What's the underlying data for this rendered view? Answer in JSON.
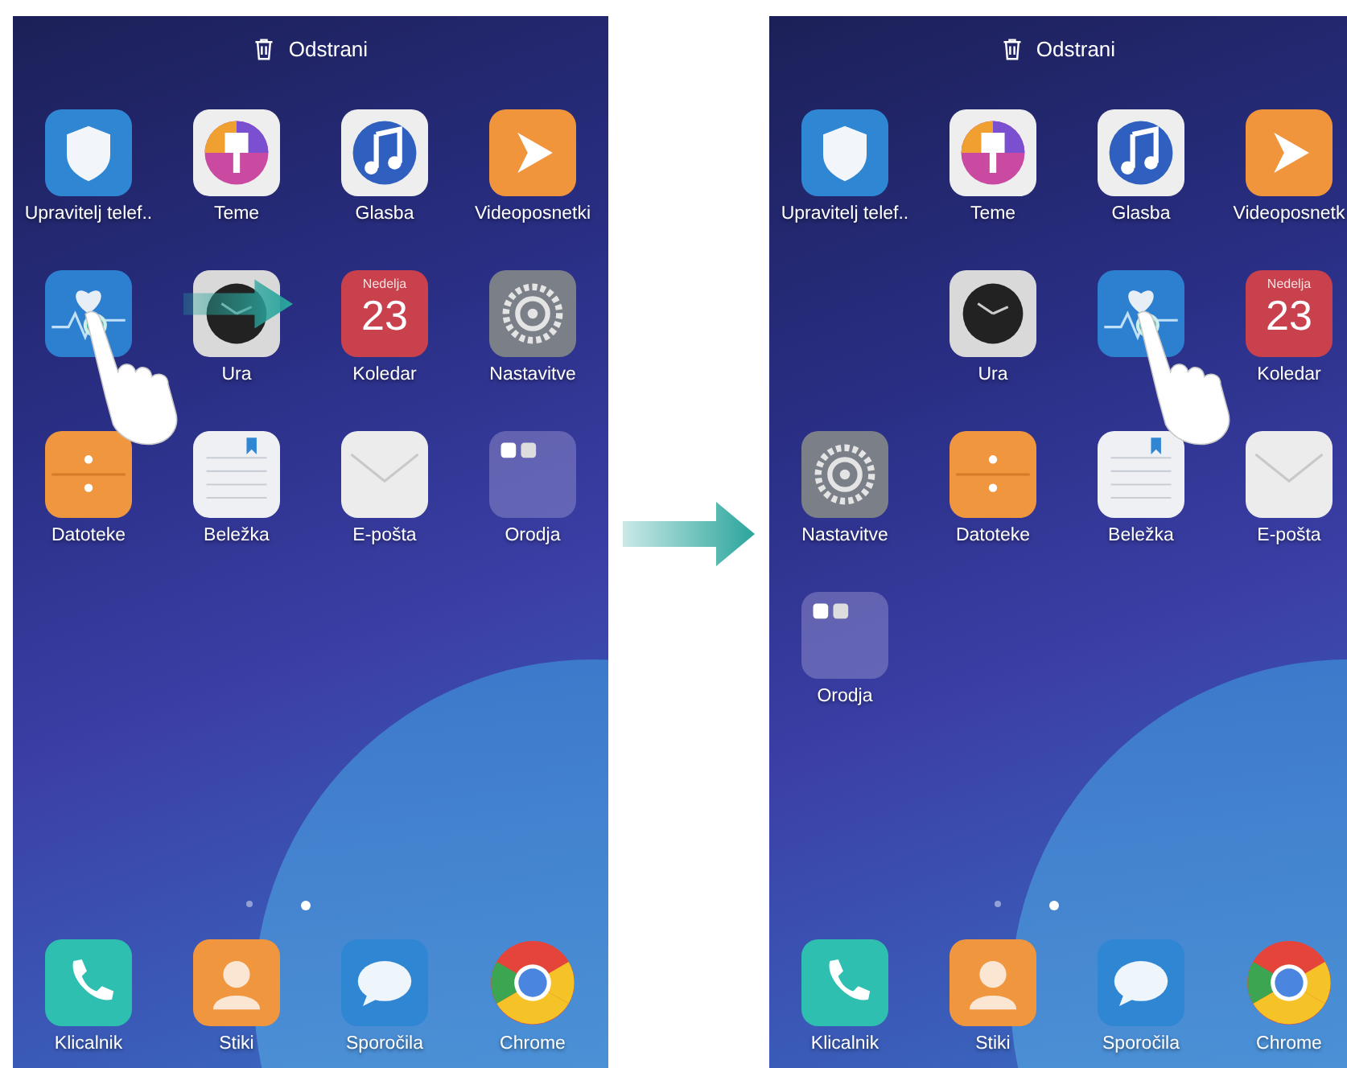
{
  "screens": [
    {
      "delete_label": "Odstrani",
      "drag_arrow": true,
      "rows": [
        [
          {
            "kind": "shield",
            "label": "Upravitelj telef.."
          },
          {
            "kind": "theme",
            "label": "Teme"
          },
          {
            "kind": "music",
            "label": "Glasba"
          },
          {
            "kind": "video",
            "label": "Videoposnetki"
          }
        ],
        [
          {
            "kind": "health",
            "dragging": true
          },
          {
            "kind": "clock",
            "label": "Ura"
          },
          {
            "kind": "calendar",
            "label": "Koledar",
            "weekday": "Nedelja",
            "day": "23"
          },
          {
            "kind": "settings",
            "label": "Nastavitve"
          }
        ],
        [
          {
            "kind": "files",
            "label": "Datoteke"
          },
          {
            "kind": "notes",
            "label": "Beležka"
          },
          {
            "kind": "mail",
            "label": "E-pošta"
          },
          {
            "kind": "folder",
            "label": "Orodja"
          }
        ]
      ],
      "page_dots": [
        {
          "selected": false
        },
        {
          "selected": true
        }
      ],
      "dock": [
        {
          "kind": "phone",
          "label": "Klicalnik"
        },
        {
          "kind": "contacts",
          "label": "Stiki"
        },
        {
          "kind": "messages",
          "label": "Sporočila"
        },
        {
          "kind": "chrome",
          "label": "Chrome"
        }
      ]
    },
    {
      "delete_label": "Odstrani",
      "drag_arrow": false,
      "rows": [
        [
          {
            "kind": "shield",
            "label": "Upravitelj telef.."
          },
          {
            "kind": "theme",
            "label": "Teme"
          },
          {
            "kind": "music",
            "label": "Glasba"
          },
          {
            "kind": "video",
            "label": "Videoposnetk"
          }
        ],
        [
          {
            "kind": "empty"
          },
          {
            "kind": "clock",
            "label": "Ura"
          },
          {
            "kind": "health",
            "dragging": true
          },
          {
            "kind": "calendar",
            "label": "Koledar",
            "weekday": "Nedelja",
            "day": "23"
          }
        ],
        [
          {
            "kind": "settings",
            "label": "Nastavitve"
          },
          {
            "kind": "files",
            "label": "Datoteke"
          },
          {
            "kind": "notes",
            "label": "Beležka"
          },
          {
            "kind": "mail",
            "label": "E-pošta"
          }
        ],
        [
          {
            "kind": "folder",
            "label": "Orodja"
          }
        ]
      ],
      "page_dots": [
        {
          "selected": false
        },
        {
          "selected": true
        }
      ],
      "dock": [
        {
          "kind": "phone",
          "label": "Klicalnik"
        },
        {
          "kind": "contacts",
          "label": "Stiki"
        },
        {
          "kind": "messages",
          "label": "Sporočila"
        },
        {
          "kind": "chrome",
          "label": "Chrome"
        }
      ]
    }
  ]
}
